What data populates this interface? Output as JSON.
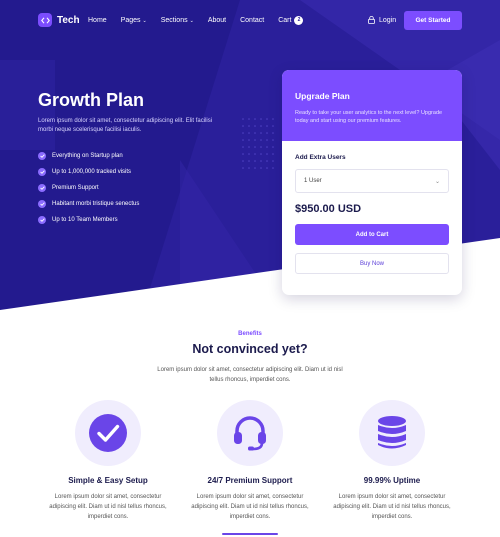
{
  "nav": {
    "brand": "Tech",
    "links": [
      "Home",
      "Pages",
      "Sections",
      "About",
      "Contact",
      "Cart"
    ],
    "cart_count": "2",
    "login": "Login",
    "cta": "Get Started"
  },
  "hero": {
    "title": "Growth Plan",
    "subtitle": "Lorem ipsum dolor sit amet, consectetur adipiscing elit. Elit facilisi morbi neque scelerisque facilisi iaculis.",
    "features": [
      "Everything on Startup plan",
      "Up to 1,000,000 tracked visits",
      "Premium Support",
      "Habitant morbi tristique senectus",
      "Up to 10 Team Members"
    ]
  },
  "card": {
    "title": "Upgrade Plan",
    "description": "Ready to take your user analytics to the next level? Upgrade today and start using our premium features.",
    "extra_label": "Add Extra Users",
    "select_value": "1 User",
    "price": "$950.00 USD",
    "add_to_cart": "Add to Cart",
    "buy_now": "Buy Now"
  },
  "benefits": {
    "eyebrow": "Benefits",
    "title": "Not convinced yet?",
    "text": "Lorem ipsum dolor sit amet, consectetur adipiscing elit. Diam ut id nisl tellus rhoncus, imperdiet cons.",
    "items": [
      {
        "title": "Simple & Easy Setup",
        "text": "Lorem ipsum dolor sit amet, consectetur adipiscing elit. Diam ut id nisl tellus rhoncus, imperdiet cons.",
        "icon": "check-circle-icon"
      },
      {
        "title": "24/7 Premium Support",
        "text": "Lorem ipsum dolor sit amet, consectetur adipiscing elit. Diam ut id nisl tellus rhoncus, imperdiet cons.",
        "icon": "headset-icon"
      },
      {
        "title": "99.99% Uptime",
        "text": "Lorem ipsum dolor sit amet, consectetur adipiscing elit. Diam ut id nisl tellus rhoncus, imperdiet cons.",
        "icon": "database-icon"
      }
    ]
  },
  "colors": {
    "hero_bg": "#2a1f9a",
    "accent": "#7c4dff",
    "heading": "#1c1b4d"
  }
}
